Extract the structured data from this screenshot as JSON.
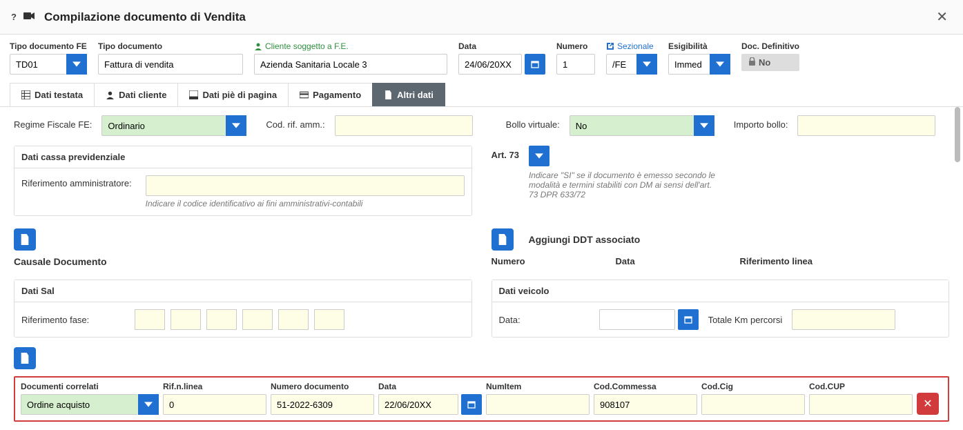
{
  "modal": {
    "title": "Compilazione documento di Vendita"
  },
  "header": {
    "tipo_doc_fe": {
      "label": "Tipo documento FE",
      "value": "TD01"
    },
    "tipo_doc": {
      "label": "Tipo documento",
      "value": "Fattura di vendita"
    },
    "cliente": {
      "label": "Cliente soggetto a F.E.",
      "value": "Azienda Sanitaria Locale 3"
    },
    "data": {
      "label": "Data",
      "value": "24/06/20XX"
    },
    "numero": {
      "label": "Numero",
      "value": "1"
    },
    "sezionale": {
      "label": "Sezionale",
      "value": "/FE"
    },
    "esigibilita": {
      "label": "Esigibilità",
      "value": "Immed"
    },
    "doc_def": {
      "label": "Doc. Definitivo",
      "value": "No"
    }
  },
  "tabs": {
    "t1": "Dati testata",
    "t2": "Dati cliente",
    "t3": "Dati piè di pagina",
    "t4": "Pagamento",
    "t5": "Altri dati"
  },
  "altri": {
    "regime_label": "Regime Fiscale FE:",
    "regime_value": "Ordinario",
    "cod_rif_label": "Cod. rif. amm.:",
    "bollo_label": "Bollo virtuale:",
    "bollo_value": "No",
    "importo_bollo_label": "Importo bollo:",
    "cassa": {
      "title": "Dati cassa previdenziale",
      "rif_amm_label": "Riferimento amministratore:",
      "hint": "Indicare il codice identificativo ai fini amministrativi-contabili"
    },
    "art73": {
      "label": "Art. 73",
      "hint": "Indicare \"SI\" se il documento è emesso secondo le modalità e termini stabiliti con DM ai sensi dell'art. 73 DPR 633/72"
    },
    "causale_label": "Causale Documento",
    "ddt": {
      "title": "Aggiungi DDT associato",
      "h1": "Numero",
      "h2": "Data",
      "h3": "Riferimento linea"
    },
    "sal": {
      "title": "Dati Sal",
      "rif_fase_label": "Riferimento fase:"
    },
    "veicolo": {
      "title": "Dati veicolo",
      "data_label": "Data:",
      "km_label": "Totale Km percorsi"
    }
  },
  "correlati": {
    "h_type": "Documenti correlati",
    "h_rif": "Rif.n.linea",
    "h_numdoc": "Numero documento",
    "h_data": "Data",
    "h_numitem": "NumItem",
    "h_comm": "Cod.Commessa",
    "h_cig": "Cod.Cig",
    "h_cup": "Cod.CUP",
    "row": {
      "type": "Ordine acquisto",
      "rif": "0",
      "numdoc": "51-2022-6309",
      "data": "22/06/20XX",
      "numitem": "",
      "comm": "908107",
      "cig": "",
      "cup": ""
    }
  }
}
